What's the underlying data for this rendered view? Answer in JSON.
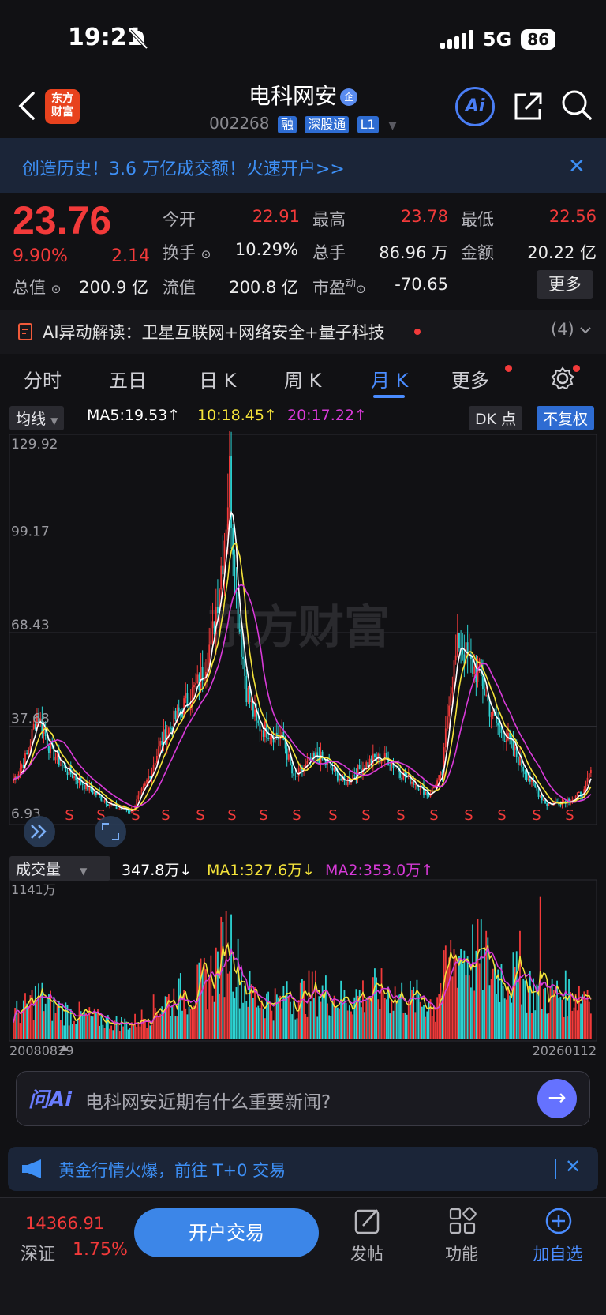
{
  "status": {
    "time": "19:21",
    "network": "5G",
    "battery": "86"
  },
  "header": {
    "logo_line1": "东方",
    "logo_line2": "财富",
    "stock_name": "电科网安",
    "verified_mark": "企",
    "stock_code": "002268",
    "tags": [
      "融",
      "深股通",
      "L1"
    ],
    "ai_label": "Ai"
  },
  "banner": {
    "text": "创造历史！3.6 万亿成交额！火速开户>>"
  },
  "quote": {
    "price": "23.76",
    "change_pct": "9.90%",
    "change": "2.14",
    "fields": {
      "open_label": "今开",
      "open": "22.91",
      "high_label": "最高",
      "high": "23.78",
      "low_label": "最低",
      "low": "22.56",
      "turnover_label": "换手",
      "turnover": "10.29%",
      "volume_label": "总手",
      "volume": "86.96 万",
      "amount_label": "金额",
      "amount": "20.22 亿",
      "mktcap_label": "总值",
      "mktcap": "200.9 亿",
      "float_label": "流值",
      "float": "200.8 亿",
      "pe_label": "市盈",
      "pe_sup": "动",
      "pe": "-70.65"
    },
    "more_label": "更多"
  },
  "ai_reading": {
    "text": "AI异动解读：卫星互联网+网络安全+量子科技",
    "count": "(4)"
  },
  "tabs": [
    "分时",
    "五日",
    "日 K",
    "周 K",
    "月 K",
    "更多"
  ],
  "ma_row": {
    "selector": "均线",
    "ma5": "MA5:19.53",
    "ma10": "10:18.45",
    "ma20": "20:17.22",
    "dk": "DK 点",
    "adjust": "不复权"
  },
  "volume_row": {
    "selector": "成交量",
    "vol": "347.8万",
    "ma1": "MA1:327.6万",
    "ma2": "MA2:353.0万"
  },
  "chart_data": {
    "type": "candlestick",
    "watermark": "东方财富",
    "price_ticks": [
      "129.92",
      "99.17",
      "68.43",
      "37.68",
      "6.93"
    ],
    "volume_max_label": "1141万",
    "start_date": "20080829",
    "end_date": "20260112",
    "signal_marker": "S",
    "colors": {
      "up": "#f23a3a",
      "down": "#2dd3d3",
      "ma5": "#ffffff",
      "ma10": "#f4e33a",
      "ma20": "#d83ad8"
    }
  },
  "ask_ai": {
    "logo": "问Ai",
    "prompt": "电科网安近期有什么重要新闻?"
  },
  "notice": {
    "text": "黄金行情火爆，前往 T+0 交易"
  },
  "bottom": {
    "index_value": "14366.91",
    "index_name": "深证",
    "index_pct": "1.75%",
    "trade": "开户交易",
    "post": "发帖",
    "functions": "功能",
    "add": "加自选"
  }
}
